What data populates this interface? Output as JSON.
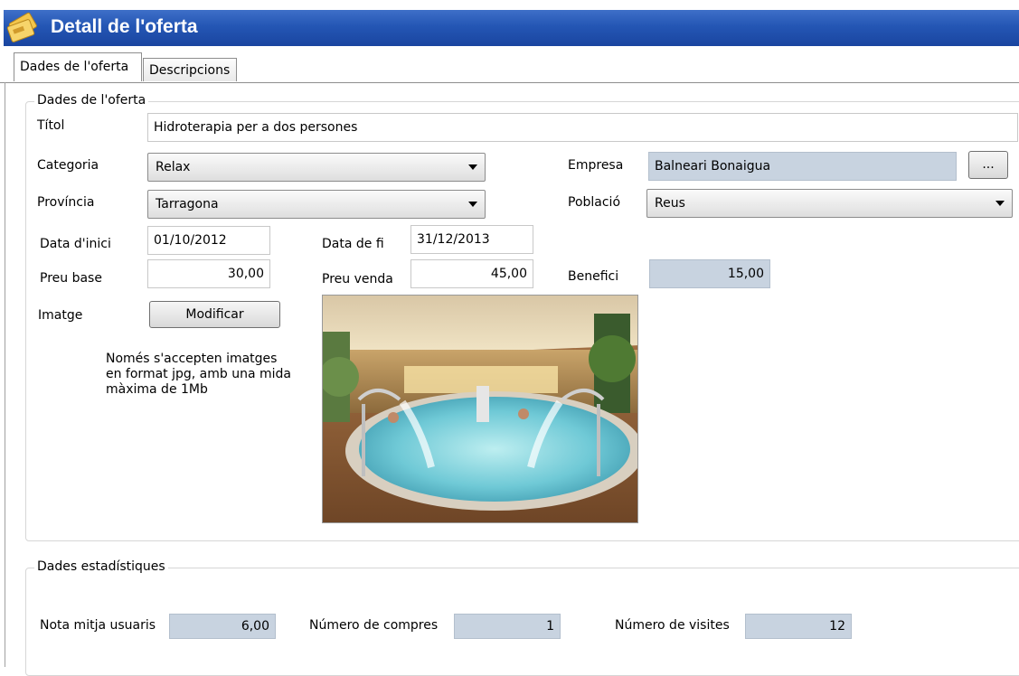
{
  "window": {
    "title": "Detall de l'oferta"
  },
  "tabs": [
    {
      "label": "Dades de l'oferta",
      "active": true
    },
    {
      "label": "Descripcions",
      "active": false
    }
  ],
  "offer_group": {
    "title": "Dades de l'oferta",
    "titol": {
      "label": "Títol",
      "value": "Hidroterapia per a dos persones"
    },
    "categoria": {
      "label": "Categoria",
      "value": "Relax"
    },
    "empresa": {
      "label": "Empresa",
      "value": "Balneari Bonaigua",
      "browse_label": "..."
    },
    "provincia": {
      "label": "Província",
      "value": "Tarragona"
    },
    "poblacio": {
      "label": "Població",
      "value": "Reus"
    },
    "data_inici": {
      "label": "Data d'inici",
      "value": "01/10/2012"
    },
    "data_fi": {
      "label": "Data de fi",
      "value": "31/12/2013"
    },
    "preu_base": {
      "label": "Preu base",
      "value": "30,00"
    },
    "preu_venda": {
      "label": "Preu venda",
      "value": "45,00"
    },
    "benefici": {
      "label": "Benefici",
      "value": "15,00"
    },
    "imatge": {
      "label": "Imatge",
      "button_label": "Modificar",
      "note_lines": [
        "Només s'accepten imatges",
        "en format jpg, amb una mida",
        "màxima de 1Mb"
      ]
    }
  },
  "stats_group": {
    "title": "Dades estadístiques",
    "nota": {
      "label": "Nota mitja usuaris",
      "value": "6,00"
    },
    "compres": {
      "label": "Número de compres",
      "value": "1"
    },
    "visites": {
      "label": "Número de visites",
      "value": "12"
    }
  },
  "colors": {
    "titlebar": "#2456b4",
    "readonly_field": "#c8d3e0",
    "pool_water": "#6fc9d6"
  }
}
